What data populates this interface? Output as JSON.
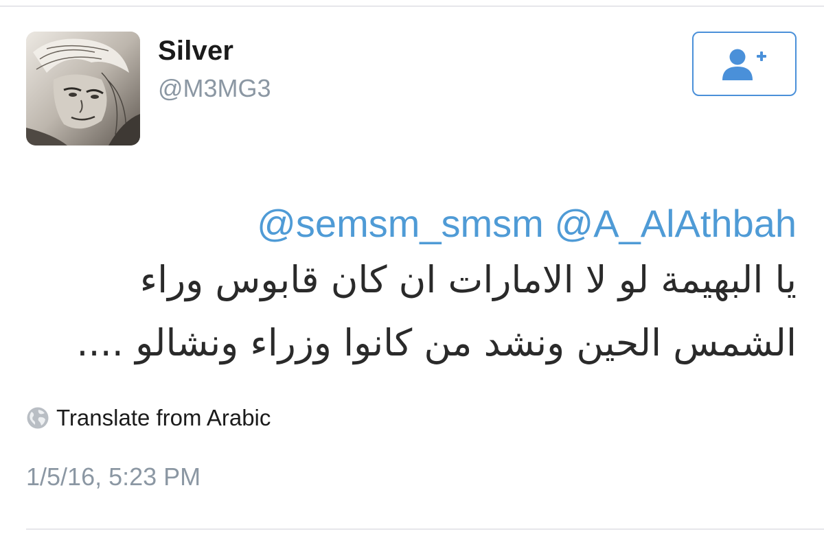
{
  "user": {
    "display_name": "Silver",
    "handle": "@M3MG3",
    "avatar_icon": "avatar-sketch-portrait"
  },
  "follow_button": {
    "icon": "add-user-icon",
    "color": "#4a90d9"
  },
  "tweet": {
    "mentions": [
      "@semsm_smsm",
      "@A_AlAthbah"
    ],
    "mention_color": "#4f9bd6",
    "lines": [
      "يا البهيمة لو لا الامارات ان كان قابوس وراء",
      "الشمس الحين ونشد من كانوا وزراء ونشالو ...."
    ]
  },
  "translate": {
    "icon": "globe-icon",
    "label": "Translate from Arabic"
  },
  "timestamp": "1/5/16, 5:23 PM"
}
